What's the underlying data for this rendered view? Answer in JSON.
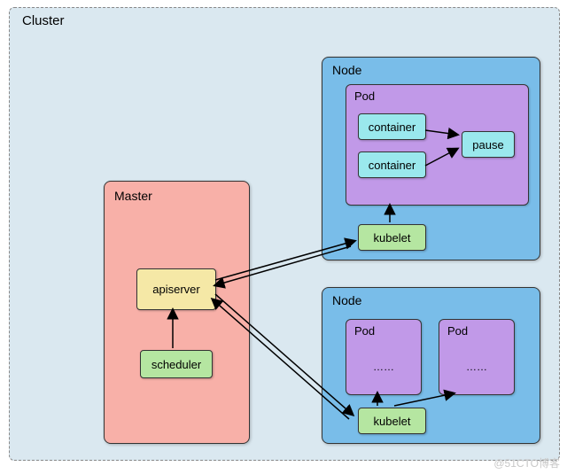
{
  "cluster_label": "Cluster",
  "master": {
    "label": "Master",
    "apiserver": "apiserver",
    "scheduler": "scheduler"
  },
  "node1": {
    "label": "Node",
    "kubelet": "kubelet",
    "pod": {
      "label": "Pod",
      "container1": "container",
      "container2": "container",
      "pause": "pause"
    }
  },
  "node2": {
    "label": "Node",
    "kubelet": "kubelet",
    "pod1": {
      "label": "Pod",
      "dots": "……"
    },
    "pod2": {
      "label": "Pod",
      "dots": "……"
    }
  },
  "watermark": "@51CTO博客"
}
